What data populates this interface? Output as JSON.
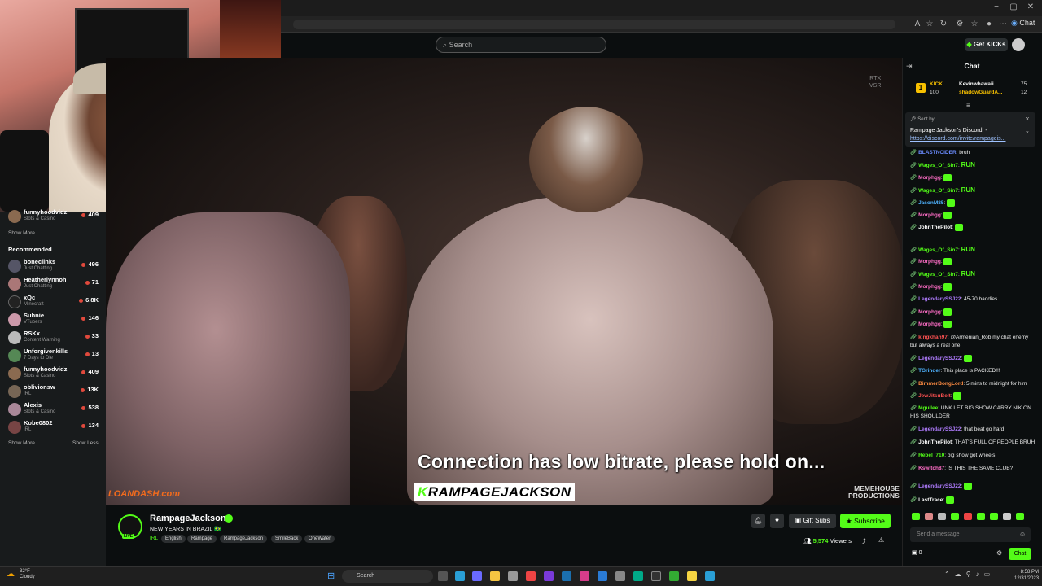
{
  "browser": {
    "chat_chip": "Chat",
    "window_controls": [
      "−",
      "▢",
      "✕"
    ]
  },
  "kick_header": {
    "search_placeholder": "Search",
    "get_kicks_label": "Get KICKs"
  },
  "sidebar": {
    "top_item": {
      "name": "funnyhoodvidz",
      "category": "Slots & Casino",
      "viewers": "409"
    },
    "show_more": "Show More",
    "recommended_title": "Recommended",
    "recommended": [
      {
        "name": "boneclinks",
        "category": "Just Chatting",
        "viewers": "496"
      },
      {
        "name": "Heatherlynnoh",
        "category": "Just Chatting",
        "viewers": "71"
      },
      {
        "name": "xQc",
        "category": "Minecraft",
        "viewers": "6.8K"
      },
      {
        "name": "Suhnie",
        "category": "VTubers",
        "viewers": "146"
      },
      {
        "name": "RSKx",
        "category": "Content Warning",
        "viewers": "33"
      },
      {
        "name": "Unforgivenkills",
        "category": "7 Days to Die",
        "viewers": "13"
      },
      {
        "name": "funnyhoodvidz",
        "category": "Slots & Casino",
        "viewers": "409"
      },
      {
        "name": "oblivionsw",
        "category": "IRL",
        "viewers": "13K"
      },
      {
        "name": "Alexis",
        "category": "Slots & Casino",
        "viewers": "538"
      },
      {
        "name": "Kobe0802",
        "category": "IRL",
        "viewers": "134"
      }
    ],
    "show_more_bottom": "Show More",
    "show_less": "Show Less"
  },
  "video": {
    "rtx_label": "RTX\nVSR",
    "low_bitrate_msg": "Connection has low bitrate, please hold on...",
    "overlay_tag_k": "K",
    "overlay_tag_rest": "RAMPAGEJACKSON",
    "sponsor_left": "LOANDASH.com",
    "sponsor_right": "MEMEHOUSE\nPRODUCTIONS"
  },
  "channel": {
    "name": "RampageJackson",
    "live_badge": "LIVE",
    "stream_title": "NEW YEARS IN BRAZIL 🇧🇷",
    "category": "IRL",
    "tags": [
      "English",
      "Rampage",
      "RampageJackson",
      "SmileBack",
      "OneWater"
    ],
    "gift_subs_label": "Gift Subs",
    "subscribe_label": "Subscribe",
    "viewers": "5,574",
    "viewers_suffix": " Viewers"
  },
  "chat": {
    "title": "Chat",
    "leaderboard": {
      "rank": "1",
      "label": "KICK",
      "points": "100",
      "user1": "Kevinwhawaii",
      "user1_value": "75",
      "user2": "shadowGuardA...",
      "user2_value": "12"
    },
    "pinned": {
      "sent_by": "Sent by",
      "message": "Rampage Jackson's Discord! -",
      "link": "https://discord.com/invite/rampageis..."
    },
    "messages": [
      {
        "user": "BLASTNCIDER",
        "color": "#6b8cff",
        "text": "bruh"
      },
      {
        "user": "Wages_Of_Sin7",
        "color": "#53fc18",
        "text": "RUN",
        "run": true
      },
      {
        "user": "Morphgg",
        "color": "#ff6ec7",
        "text": "",
        "emote": true
      },
      {
        "user": "Wages_Of_Sin7",
        "color": "#53fc18",
        "text": "RUN",
        "run": true
      },
      {
        "user": "JasonM85",
        "color": "#4fb3ff",
        "text": "",
        "emote": true
      },
      {
        "user": "Morphgg",
        "color": "#ff6ec7",
        "text": "",
        "emote": true
      },
      {
        "user": "JohnThePilot",
        "color": "#ffffff",
        "text": "",
        "emote": true
      },
      {
        "user": "Wages_Of_Sin7",
        "color": "#53fc18",
        "text": "RUN",
        "run": true
      },
      {
        "user": "Morphgg",
        "color": "#ff6ec7",
        "text": "",
        "emote": true
      },
      {
        "user": "Wages_Of_Sin7",
        "color": "#53fc18",
        "text": "RUN",
        "run": true
      },
      {
        "user": "Morphgg",
        "color": "#ff6ec7",
        "text": "",
        "emote": true
      },
      {
        "user": "LegendarySSJ22",
        "color": "#b07cff",
        "text": "45-70 baddies"
      },
      {
        "user": "Morphgg",
        "color": "#ff6ec7",
        "text": "",
        "emote": true
      },
      {
        "user": "Morphgg",
        "color": "#ff6ec7",
        "text": "",
        "emote": true
      },
      {
        "user": "kingkhan97",
        "color": "#ff5252",
        "text": "@Armenian_Rob my chat enemy but always a real one"
      },
      {
        "user": "LegendarySSJ22",
        "color": "#b07cff",
        "text": "",
        "emote": true
      },
      {
        "user": "TGrinder",
        "color": "#4fb3ff",
        "text": "This place is PACKED!!!"
      },
      {
        "user": "BimmerBongLord",
        "color": "#ff8c42",
        "text": "5 mins to midnight for him"
      },
      {
        "user": "JewJitsuBelt",
        "color": "#ff5252",
        "text": "",
        "emote": true
      },
      {
        "user": "Mguilee",
        "color": "#53fc18",
        "text": "UNK LET BIG SHOW CARRY NIK ON HIS SHOULDER"
      },
      {
        "user": "LegendarySSJ22",
        "color": "#b07cff",
        "text": "that beat go hard"
      },
      {
        "user": "JohnThePilot",
        "color": "#ffffff",
        "text": "THAT'S FULL OF PEOPLE BRUH"
      },
      {
        "user": "Rebel_710",
        "color": "#53fc18",
        "text": "big show got wheels"
      },
      {
        "user": "Kswitch87",
        "color": "#ff6ec7",
        "text": "IS THIS THE SAME CLUB?"
      },
      {
        "user": "LegendarySSJ22",
        "color": "#b07cff",
        "text": "",
        "emote": true
      },
      {
        "user": "LastTrace",
        "color": "#ffffff",
        "text": "",
        "emote": true
      }
    ],
    "input_placeholder": "Send a message",
    "kicks_count": "0",
    "send_label": "Chat"
  },
  "taskbar": {
    "weather_temp": "32°F",
    "weather_desc": "Cloudy",
    "search_label": "Search",
    "time": "8:58 PM",
    "date": "12/31/2023"
  }
}
